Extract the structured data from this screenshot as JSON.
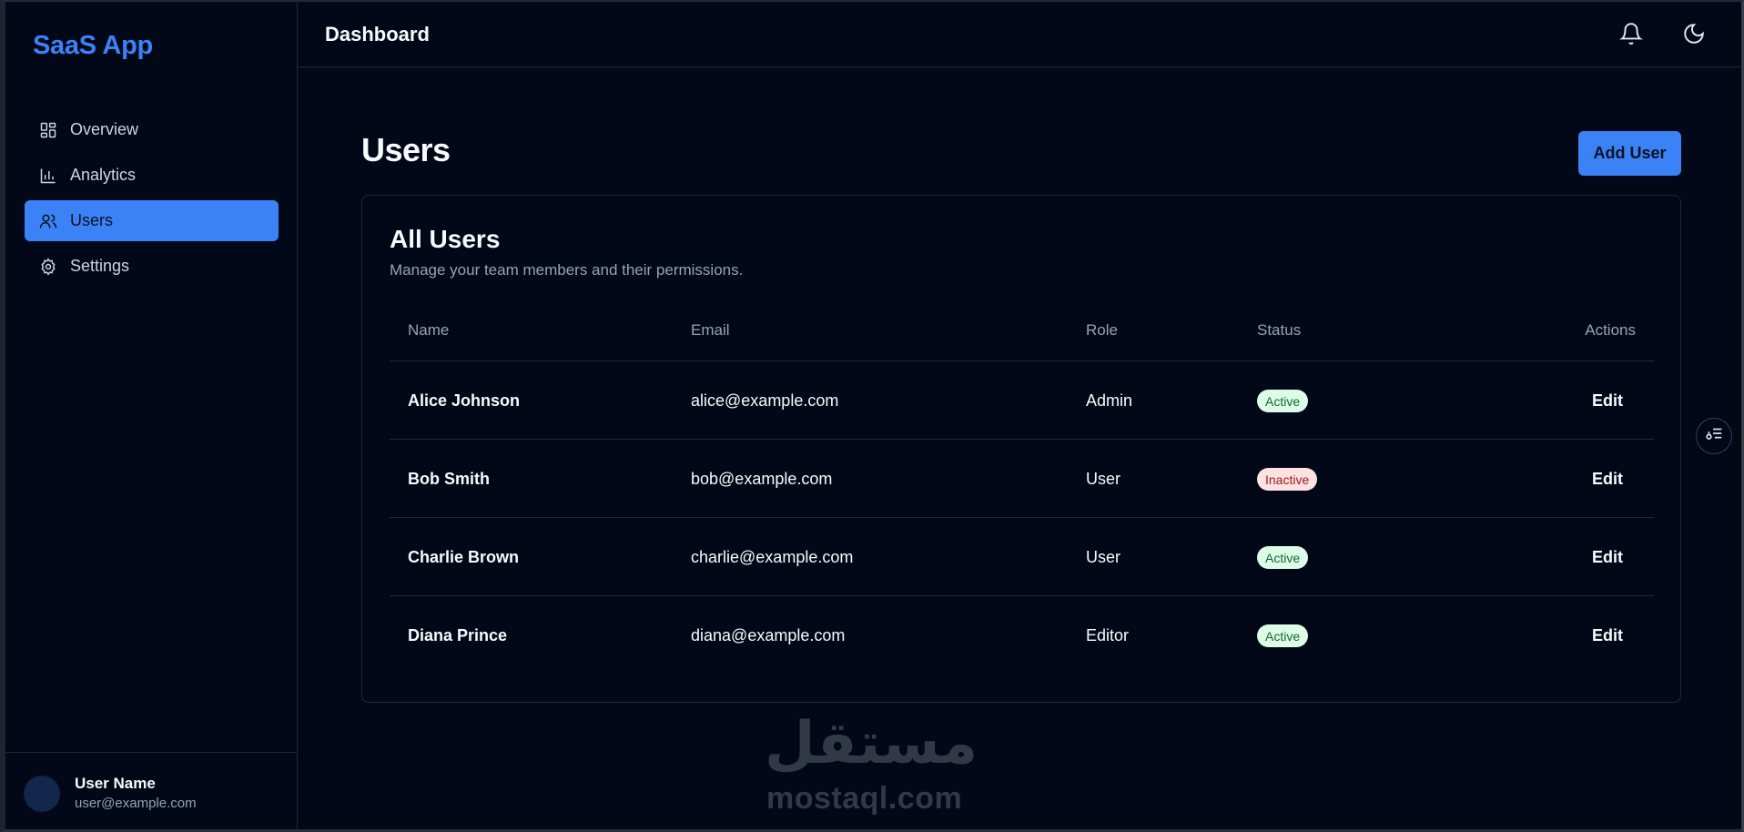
{
  "sidebar": {
    "brand": "SaaS App",
    "items": [
      {
        "label": "Overview",
        "icon": "dashboard-grid-icon"
      },
      {
        "label": "Analytics",
        "icon": "bar-chart-icon"
      },
      {
        "label": "Users",
        "icon": "users-icon",
        "active": true
      },
      {
        "label": "Settings",
        "icon": "gear-icon"
      }
    ],
    "user": {
      "name": "User Name",
      "email": "user@example.com"
    }
  },
  "header": {
    "title": "Dashboard",
    "icons": [
      "bell-icon",
      "moon-icon"
    ]
  },
  "main": {
    "page_title": "Users",
    "add_user_label": "Add User",
    "card": {
      "title": "All Users",
      "subtitle": "Manage your team members and their permissions.",
      "columns": [
        "Name",
        "Email",
        "Role",
        "Status",
        "Actions"
      ],
      "rows": [
        {
          "name": "Alice Johnson",
          "email": "alice@example.com",
          "role": "Admin",
          "status": "Active",
          "action": "Edit"
        },
        {
          "name": "Bob Smith",
          "email": "bob@example.com",
          "role": "User",
          "status": "Inactive",
          "action": "Edit"
        },
        {
          "name": "Charlie Brown",
          "email": "charlie@example.com",
          "role": "User",
          "status": "Active",
          "action": "Edit"
        },
        {
          "name": "Diana Prince",
          "email": "diana@example.com",
          "role": "Editor",
          "status": "Active",
          "action": "Edit"
        }
      ]
    }
  },
  "floating_button": {
    "icon": "filter-settings-icon"
  },
  "watermark": {
    "arabic": "مستقل",
    "latin": "mostaql.com"
  },
  "colors": {
    "background": "#020817",
    "accent": "#3b82f6",
    "border": "#1e293b",
    "muted_text": "#94a3b8",
    "active_badge_bg": "#dcfce7",
    "active_badge_text": "#166534",
    "inactive_badge_bg": "#fee2e2",
    "inactive_badge_text": "#991b1b"
  }
}
